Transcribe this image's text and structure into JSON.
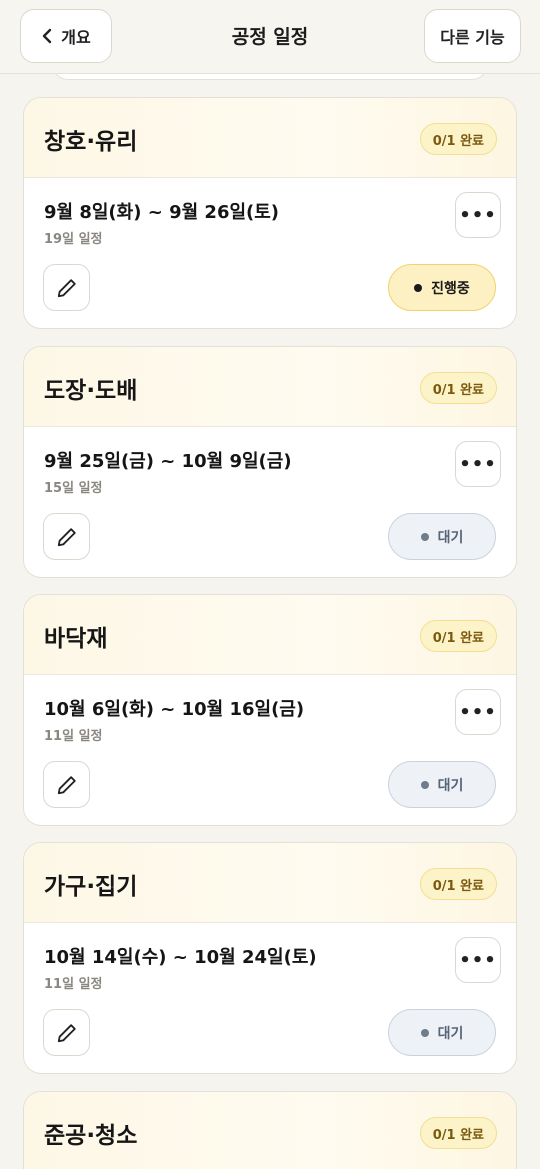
{
  "header": {
    "back_label": "개요",
    "title": "공정 일정",
    "more_label": "다른 기능"
  },
  "tasks": [
    {
      "title": "창호·유리",
      "badge": "0/1 완료",
      "date_range": "9월 8일(화) ~ 9월 26일(토)",
      "duration": "19일 일정",
      "status": "진행중",
      "menu": "•••"
    },
    {
      "title": "도장·도배",
      "badge": "0/1 완료",
      "date_range": "9월 25일(금) ~ 10월 9일(금)",
      "duration": "15일 일정",
      "status": "대기",
      "menu": "•••"
    },
    {
      "title": "바닥재",
      "badge": "0/1 완료",
      "date_range": "10월 6일(화) ~ 10월 16일(금)",
      "duration": "11일 일정",
      "status": "대기",
      "menu": "•••"
    },
    {
      "title": "가구·집기",
      "badge": "0/1 완료",
      "date_range": "10월 14일(수) ~ 10월 24일(토)",
      "duration": "11일 일정",
      "status": "대기",
      "menu": "•••"
    },
    {
      "title": "준공·청소",
      "badge": "0/1 완료"
    }
  ],
  "colors": {
    "background": "#f6f4ef",
    "badge_bg": "#fdf3c8",
    "active_bg": "#fdf0c2",
    "wait_bg": "#eef2f6"
  }
}
